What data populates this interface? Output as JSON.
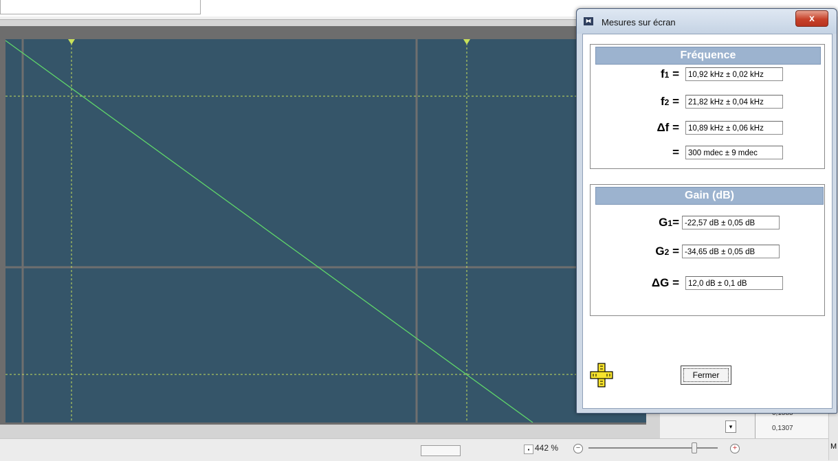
{
  "dialog": {
    "title": "Mesures sur écran",
    "close_label": "x",
    "frequency": {
      "header": "Fréquence",
      "rows": [
        {
          "symbol": "f",
          "sub": "1",
          "eq": "=",
          "value": "10,92 kHz ± 0,02 kHz"
        },
        {
          "symbol": "f",
          "sub": "2",
          "eq": "=",
          "value": "21,82 kHz ± 0,04 kHz"
        },
        {
          "symbol": "Δf",
          "sub": "",
          "eq": "=",
          "value": "10,89 kHz ± 0,06 kHz"
        },
        {
          "symbol": "",
          "sub": "",
          "eq": "=",
          "value": "300 mdec ± 9 mdec"
        }
      ]
    },
    "gain": {
      "header": "Gain (dB)",
      "rows": [
        {
          "symbol": "G",
          "sub": "1",
          "eq": "=",
          "value": "-22,57 dB ± 0,05 dB"
        },
        {
          "symbol": "G",
          "sub": "2",
          "eq": "=",
          "value": "-34,65 dB ± 0,05 dB"
        },
        {
          "symbol": "ΔG",
          "sub": "",
          "eq": "=",
          "value": "12,0 dB ± 0,1 dB"
        }
      ]
    },
    "close_button": "Fermer"
  },
  "statusbar": {
    "zoom_text": "442 %",
    "zoom_step_glyph": "⬝",
    "zoom_minus": "−",
    "zoom_plus": "+",
    "zoom_level_fraction": 0.82,
    "scroll_down_glyph": "▾",
    "right_panel_values": [
      "0,1585",
      "0,1307"
    ],
    "right_edge_letter": "M"
  },
  "colors": {
    "plot_bg": "#355569",
    "grid_major": "#6f6f6f",
    "grid_cursor": "#c8e05a",
    "trace": "#5fd66a",
    "group_header": "#9cb3cf"
  }
}
